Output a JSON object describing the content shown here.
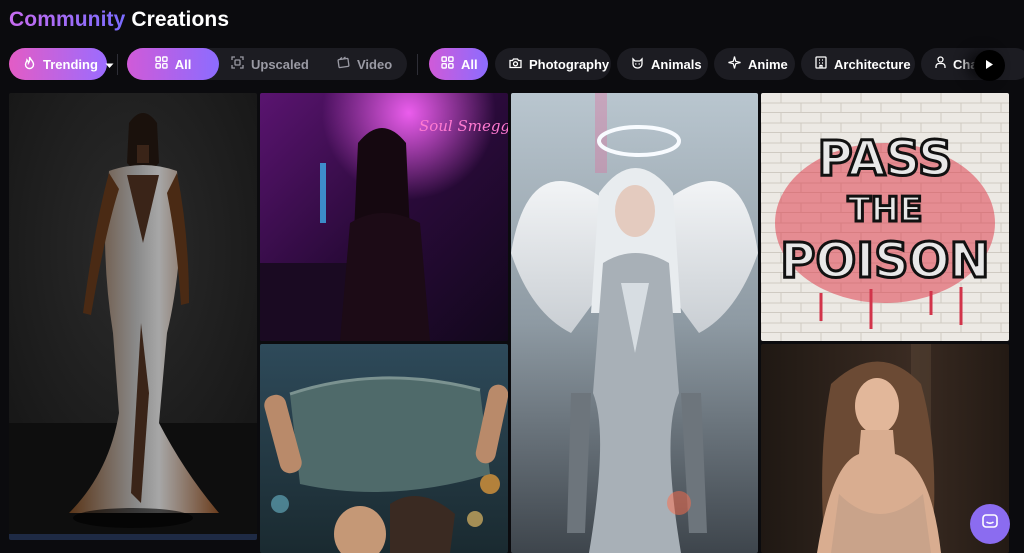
{
  "header": {
    "title_part1": "Community",
    "title_part2": "Creations"
  },
  "filters": {
    "sort": {
      "label": "Trending",
      "icon": "flame-icon"
    },
    "type_tabs": [
      {
        "label": "All",
        "icon": "grid-icon",
        "active": true
      },
      {
        "label": "Upscaled",
        "icon": "upscale-icon",
        "active": false
      },
      {
        "label": "Video",
        "icon": "video-icon",
        "active": false
      }
    ],
    "categories": [
      {
        "label": "All",
        "icon": "grid-icon",
        "active": true
      },
      {
        "label": "Photography",
        "icon": "camera-icon",
        "active": false
      },
      {
        "label": "Animals",
        "icon": "cat-icon",
        "active": false
      },
      {
        "label": "Anime",
        "icon": "sparkle-icon",
        "active": false
      },
      {
        "label": "Architecture",
        "icon": "building-icon",
        "active": false
      },
      {
        "label": "Cha",
        "icon": "person-icon",
        "active": false
      }
    ]
  },
  "gallery": {
    "images": [
      {
        "id": "fashion-model-gown"
      },
      {
        "id": "neon-bar-woman"
      },
      {
        "id": "angel-warrior"
      },
      {
        "id": "graffiti-wall"
      },
      {
        "id": "rain-friends-umbrella"
      },
      {
        "id": "portrait-woman-wavy-hair"
      }
    ],
    "graffiti_text": [
      "PASS",
      "THE",
      "POISON"
    ],
    "neon_sign_text": "Soul Smeggat"
  },
  "colors": {
    "accent_start": "#e35cc5",
    "accent_end": "#8c6cff",
    "background": "#0b0b0e",
    "chip_bg": "#1c1c22"
  }
}
